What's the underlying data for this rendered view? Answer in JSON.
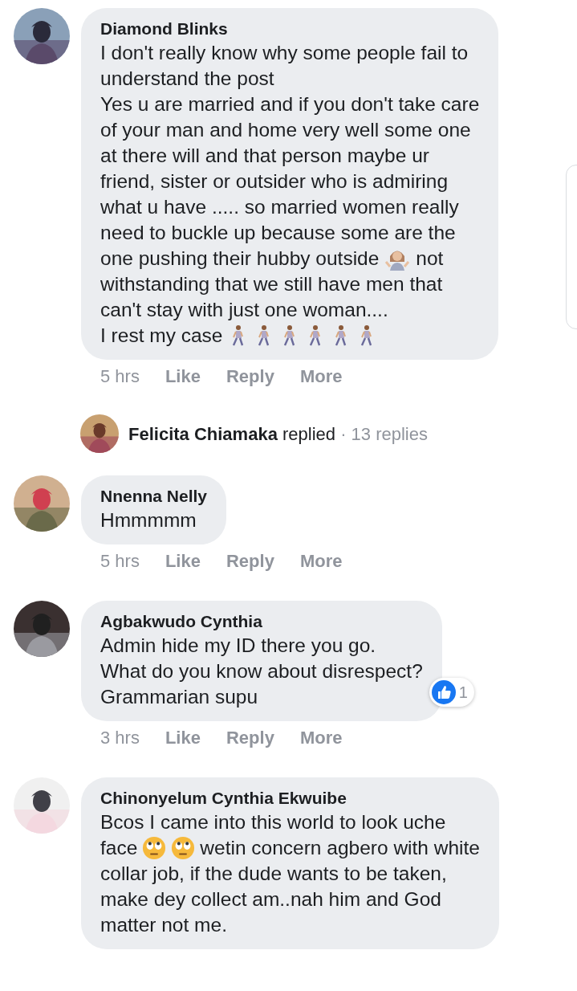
{
  "comments": [
    {
      "kind": "comment",
      "author": "Diamond Blinks",
      "lines": [
        [
          {
            "kind": "text",
            "text": "I don't really know why some people fail to"
          }
        ],
        [
          {
            "kind": "text",
            "text": "understand the post"
          }
        ],
        [
          {
            "kind": "text",
            "text": "Yes u are married and if you don't take care"
          }
        ],
        [
          {
            "kind": "text",
            "text": "of your man and home very well some one"
          }
        ],
        [
          {
            "kind": "text",
            "text": "at there will and that person maybe ur"
          }
        ],
        [
          {
            "kind": "text",
            "text": "friend, sister or outsider who is admiring"
          }
        ],
        [
          {
            "kind": "text",
            "text": "what u have ..... so married women really"
          }
        ],
        [
          {
            "kind": "text",
            "text": "need to buckle up because some are the"
          }
        ],
        [
          {
            "kind": "text",
            "text": "one pushing their hubby outside"
          },
          {
            "kind": "shrug-emoji"
          },
          {
            "kind": "text",
            "text": "not"
          }
        ],
        [
          {
            "kind": "text",
            "text": "withstanding that we still have men that"
          }
        ],
        [
          {
            "kind": "text",
            "text": "can't stay with just one woman...."
          }
        ],
        [
          {
            "kind": "text",
            "text": "I rest my case"
          },
          {
            "kind": "walking-emoji"
          },
          {
            "kind": "walking-emoji"
          },
          {
            "kind": "walking-emoji"
          },
          {
            "kind": "walking-emoji"
          },
          {
            "kind": "walking-emoji"
          },
          {
            "kind": "walking-emoji"
          }
        ]
      ],
      "time": "5 hrs",
      "actions": [
        "Like",
        "Reply",
        "More"
      ]
    },
    {
      "kind": "replies",
      "author": "Felicita Chiamaka",
      "verb": "replied",
      "count": "· 13 replies"
    },
    {
      "kind": "comment",
      "author": "Nnenna Nelly",
      "lines": [
        [
          {
            "kind": "text",
            "text": "Hmmmmm"
          }
        ]
      ],
      "time": "5 hrs",
      "actions": [
        "Like",
        "Reply",
        "More"
      ]
    },
    {
      "kind": "comment",
      "author": "Agbakwudo Cynthia",
      "lines": [
        [
          {
            "kind": "text",
            "text": "Admin hide my ID there you go."
          }
        ],
        [
          {
            "kind": "text",
            "text": "What do you know about disrespect?"
          }
        ],
        [
          {
            "kind": "text",
            "text": "Grammarian supu"
          }
        ]
      ],
      "reactions": "1",
      "time": "3 hrs",
      "actions": [
        "Like",
        "Reply",
        "More"
      ]
    },
    {
      "kind": "comment",
      "author": "Chinonyelum Cynthia Ekwuibe",
      "lines": [
        [
          {
            "kind": "text",
            "text": "Bcos I came into this world to look uche"
          }
        ],
        [
          {
            "kind": "text",
            "text": "face"
          },
          {
            "kind": "eye-roll-emoji"
          },
          {
            "kind": "eye-roll-emoji"
          },
          {
            "kind": "text",
            "text": "wetin concern agbero with white"
          }
        ],
        [
          {
            "kind": "text",
            "text": "collar job, if the dude wants to be taken,"
          }
        ],
        [
          {
            "kind": "text",
            "text": "make dey collect am..nah him and God"
          }
        ],
        [
          {
            "kind": "text",
            "text": "matter not me."
          }
        ]
      ]
    }
  ]
}
